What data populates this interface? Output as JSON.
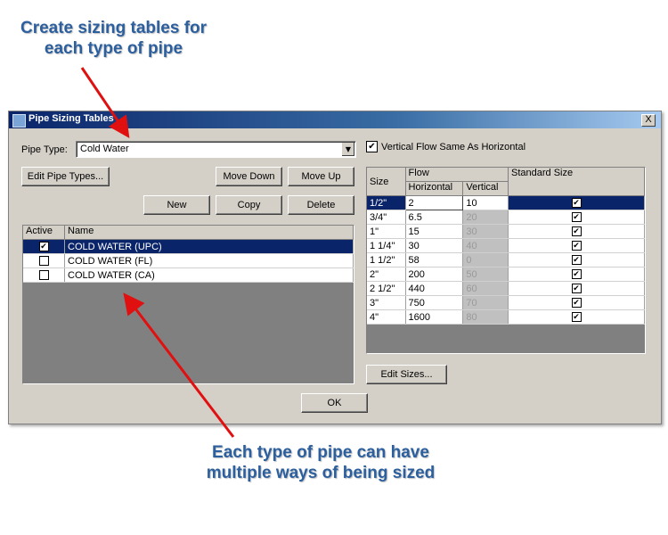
{
  "annotations": {
    "top_line1": "Create sizing tables for",
    "top_line2": "each type of pipe",
    "bottom_line1": "Each type of pipe can have",
    "bottom_line2": "multiple ways of being sized",
    "color": "#2c5f9e",
    "arrow_color": "#e01010"
  },
  "dialog": {
    "title": "Pipe Sizing Tables",
    "close_label": "X",
    "pipe_type_label": "Pipe Type:",
    "pipe_type_value": "Cold Water",
    "vertical_flow_label": "Vertical Flow Same As Horizontal",
    "vertical_flow_checked": true,
    "buttons": {
      "edit_pipe_types": "Edit Pipe Types...",
      "move_down": "Move Down",
      "move_up": "Move Up",
      "new": "New",
      "copy": "Copy",
      "delete": "Delete",
      "edit_sizes": "Edit Sizes...",
      "ok": "OK"
    },
    "methods_table": {
      "headers": {
        "active": "Active",
        "name": "Name"
      },
      "rows": [
        {
          "active": true,
          "name": "COLD WATER (UPC)",
          "selected": true
        },
        {
          "active": false,
          "name": "COLD WATER (FL)",
          "selected": false
        },
        {
          "active": false,
          "name": "COLD WATER (CA)",
          "selected": false
        }
      ]
    },
    "sizes_table": {
      "headers": {
        "size": "Size",
        "flow": "Flow",
        "horizontal": "Horizontal",
        "vertical": "Vertical",
        "standard": "Standard Size"
      },
      "rows": [
        {
          "size": "1/2\"",
          "horizontal": "2",
          "vertical": "10",
          "standard": true,
          "selected": true
        },
        {
          "size": "3/4\"",
          "horizontal": "6.5",
          "vertical": "20",
          "standard": true
        },
        {
          "size": "1\"",
          "horizontal": "15",
          "vertical": "30",
          "standard": true
        },
        {
          "size": "1 1/4\"",
          "horizontal": "30",
          "vertical": "40",
          "standard": true
        },
        {
          "size": "1 1/2\"",
          "horizontal": "58",
          "vertical": "0",
          "standard": true
        },
        {
          "size": "2\"",
          "horizontal": "200",
          "vertical": "50",
          "standard": true
        },
        {
          "size": "2 1/2\"",
          "horizontal": "440",
          "vertical": "60",
          "standard": true
        },
        {
          "size": "3\"",
          "horizontal": "750",
          "vertical": "70",
          "standard": true
        },
        {
          "size": "4\"",
          "horizontal": "1600",
          "vertical": "80",
          "standard": true
        }
      ]
    }
  }
}
